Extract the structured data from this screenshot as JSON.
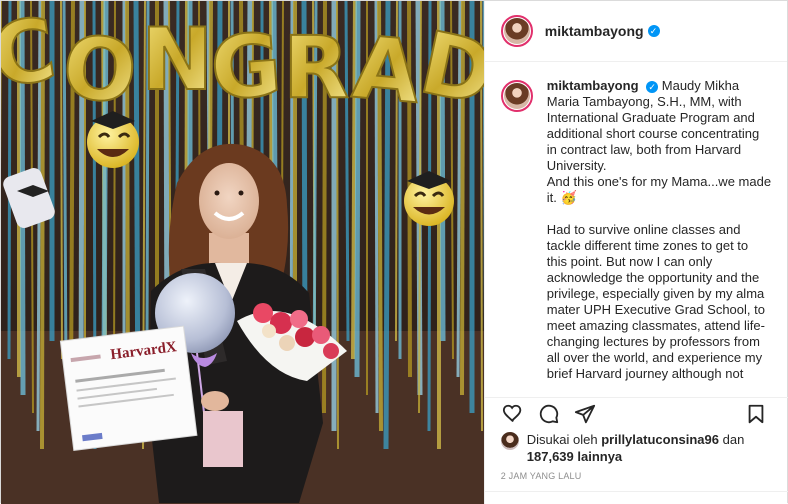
{
  "post": {
    "username": "miktambayong",
    "caption": {
      "username": "miktambayong",
      "text": "Maudy Mikha Maria Tambayong, S.H., MM, with International Graduate Program and additional short course concentrating in contract law, both from Harvard University.\nAnd this one's for my Mama...we made it. 🥳\n\nHad to survive online classes and tackle different time zones to get to this point. But now I can only acknowledge the opportunity and the privilege, especially given by my alma mater UPH Executive Grad School, to meet amazing classmates, attend life-changing lectures by professors from all over the world, and experience my brief Harvard journey although not"
    },
    "likes": {
      "prefix": "Disukai oleh",
      "liker": "prillylatuconsina96",
      "connector": "dan",
      "count": "187,639 lainnya"
    },
    "timestamp": "2 JAM YANG LALU",
    "photo": {
      "balloon_word": "CONGRAD",
      "certificate_brand": "HarvardX"
    }
  },
  "icons": {
    "like": "heart-icon",
    "comment": "comment-icon",
    "share": "share-icon",
    "save": "bookmark-icon",
    "verified": "verified-badge-icon"
  },
  "colors": {
    "verified": "#0095f6",
    "story_ring": "#e1306c",
    "muted": "#8e8e8e"
  }
}
